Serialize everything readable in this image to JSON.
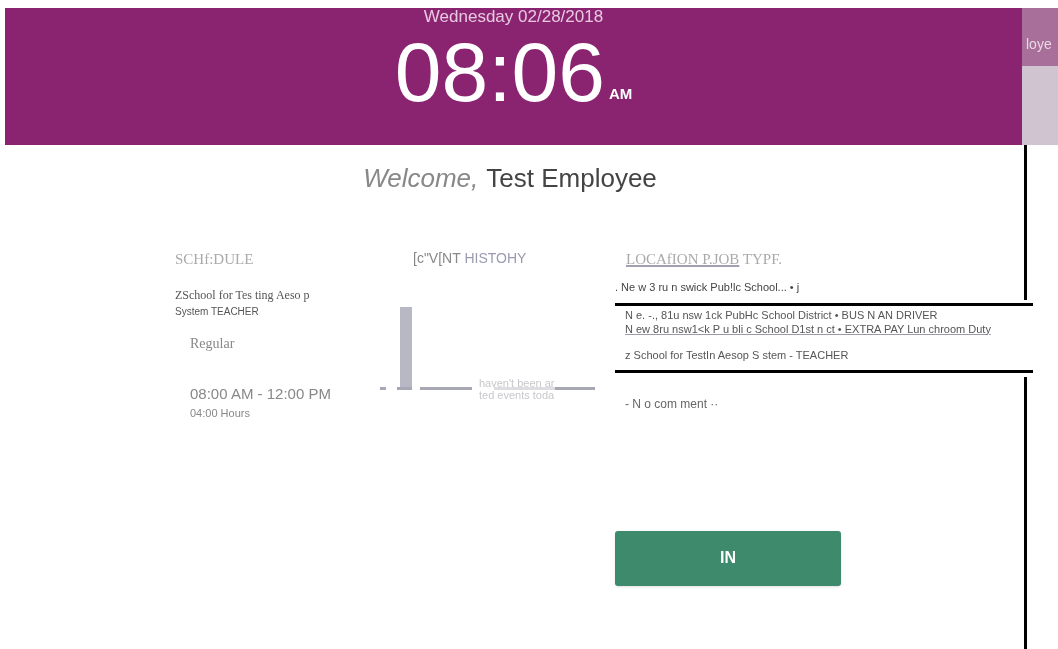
{
  "header": {
    "date": "Wednesday 02/28/2018",
    "time": "08:06",
    "meridiem": "AM",
    "side_tab": "loye"
  },
  "welcome": {
    "greeting": "Welcome,",
    "name": "Test Employee"
  },
  "schedule": {
    "title": "SCHf:DULE",
    "location": "ZSchool for Tes ting Aeso p",
    "job": "System TEACHER",
    "shift_type": "Regular",
    "hours": "08:00 AM - 12:00 PM",
    "duration": "04:00 Hours"
  },
  "event_history": {
    "title_prefix": "[c\"V[NT ",
    "title": "HISTOHY",
    "message": [
      "haven't been ar",
      "ted events toda"
    ]
  },
  "location": {
    "title_underlined": "LOCAfION P.JOB",
    "title_rest": " TYPF.",
    "value": ". Ne w 3 ru n swick Pub!lc School... • j",
    "options": [
      {
        "label": "N e. -., 81u nsw 1ck PubHc School District • BUS N AN DRIVER",
        "hovered": false
      },
      {
        "label": "N ew 8ru nsw1<k P u bli c School D1st n ct • EXTRA PAY Lun chroom Duty",
        "hovered": true
      },
      {
        "label": "z School for TestIn Aesop S stem - TEACHER",
        "hovered": false
      }
    ],
    "comment": "- N o com ment ··"
  },
  "button": "IN"
}
